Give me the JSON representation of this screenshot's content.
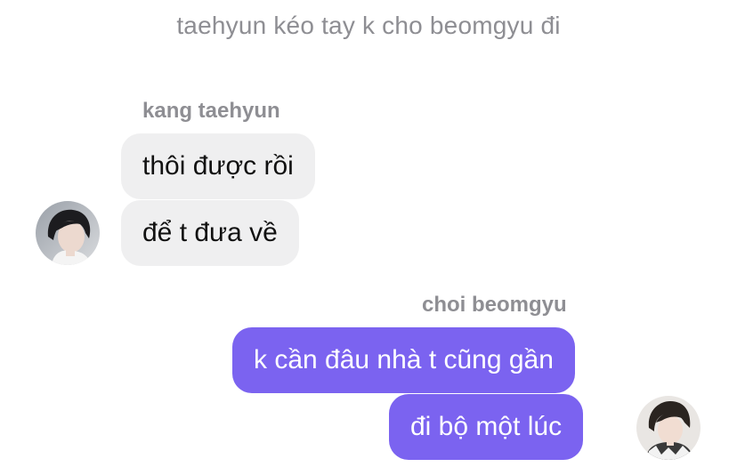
{
  "system_message": "taehyun kéo tay k cho beomgyu đi",
  "thread": {
    "incoming": {
      "sender_name": "kang taehyun",
      "messages": [
        "thôi được rồi",
        "để t đưa về"
      ]
    },
    "outgoing": {
      "sender_name": "choi beomgyu",
      "messages": [
        "k cần đâu nhà t cũng gần",
        "đi bộ một lúc"
      ]
    }
  },
  "colors": {
    "incoming_bubble": "#efeff0",
    "outgoing_bubble": "#7b63f0",
    "meta_text": "#8e8e93"
  },
  "icons": {
    "incoming_avatar": "avatar-taehyun",
    "outgoing_avatar": "avatar-beomgyu"
  }
}
